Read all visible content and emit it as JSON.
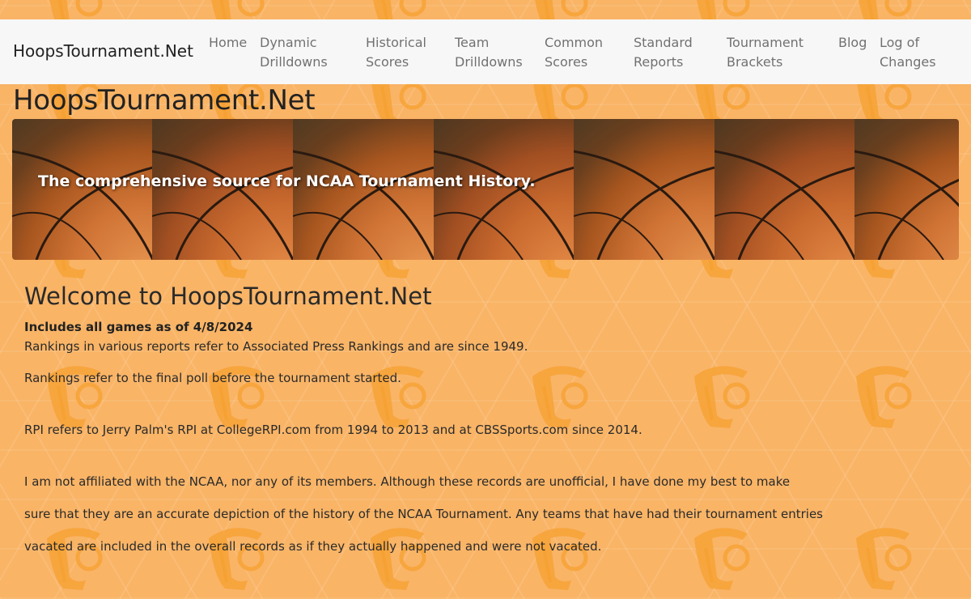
{
  "navbar": {
    "brand": "HoopsTournament.Net",
    "links": [
      {
        "label": "Home"
      },
      {
        "label": "Dynamic\nDrilldowns"
      },
      {
        "label": "Historical\nScores"
      },
      {
        "label": "Team\nDrilldowns"
      },
      {
        "label": "Common\nScores"
      },
      {
        "label": "Standard\nReports"
      },
      {
        "label": "Tournament\nBrackets"
      },
      {
        "label": "Blog"
      },
      {
        "label": "Log of\nChanges"
      }
    ]
  },
  "header": {
    "site_title": "HoopsTournament.Net",
    "banner_text": "The comprehensive source for NCAA Tournament History."
  },
  "main": {
    "welcome": "Welcome to HoopsTournament.Net",
    "as_of": "Includes all games as of 4/8/2024",
    "paragraphs": [
      "Rankings in various reports refer to Associated Press Rankings and are since 1949.",
      "Rankings refer to the final poll before the tournament started.",
      "RPI refers to Jerry Palm's RPI at CollegeRPI.com from 1994 to 2013 and at CBSSports.com since 2014.",
      "I am not affiliated with the NCAA, nor any of its members. Although these records are unofficial, I have done my best to make",
      "sure that they are an accurate depiction of the history of the NCAA Tournament. Any teams that have had their tournament entries",
      "vacated are included in the overall records as if they actually happened and were not vacated."
    ]
  },
  "colors": {
    "page_background": "#f9b466",
    "navbar_background": "#f7f7f7",
    "mascot": "#f5a030"
  },
  "icons": {
    "background_mascot": "trojan-helmet-icon",
    "banner_image": "basketball-image"
  }
}
